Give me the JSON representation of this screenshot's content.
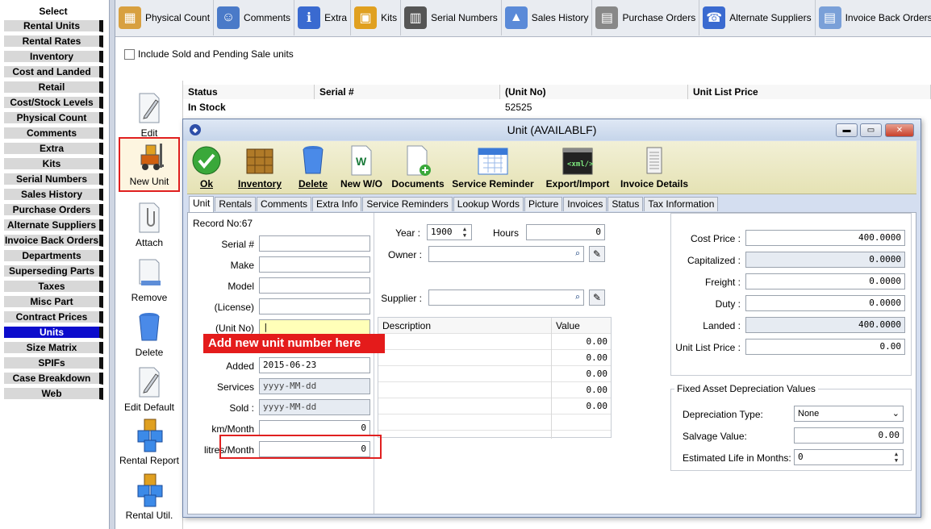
{
  "leftnav": {
    "header": "Select",
    "items": [
      {
        "label": "Rental Units",
        "active": false
      },
      {
        "label": "Rental Rates",
        "active": false
      },
      {
        "label": "Inventory",
        "active": false
      },
      {
        "label": "Cost and Landed",
        "active": false
      },
      {
        "label": "Retail",
        "active": false
      },
      {
        "label": "Cost/Stock Levels",
        "active": false
      },
      {
        "label": "Physical Count",
        "active": false
      },
      {
        "label": "Comments",
        "active": false
      },
      {
        "label": "Extra",
        "active": false
      },
      {
        "label": "Kits",
        "active": false
      },
      {
        "label": "Serial Numbers",
        "active": false
      },
      {
        "label": "Sales History",
        "active": false
      },
      {
        "label": "Purchase Orders",
        "active": false
      },
      {
        "label": "Alternate Suppliers",
        "active": false
      },
      {
        "label": "Invoice Back Orders",
        "active": false
      },
      {
        "label": "Departments",
        "active": false
      },
      {
        "label": "Superseding Parts",
        "active": false
      },
      {
        "label": "Taxes",
        "active": false
      },
      {
        "label": "Misc Part",
        "active": false
      },
      {
        "label": "Contract Prices",
        "active": false
      },
      {
        "label": "Units",
        "active": true
      },
      {
        "label": "Size Matrix",
        "active": false
      },
      {
        "label": "SPIFs",
        "active": false
      },
      {
        "label": "Case Breakdown",
        "active": false
      },
      {
        "label": "Web",
        "active": false
      }
    ]
  },
  "toptoolbar": {
    "items": [
      {
        "label": "Physical Count",
        "icon": "clipboard-box-icon"
      },
      {
        "label": "Comments",
        "icon": "people-icon"
      },
      {
        "label": "Extra",
        "icon": "info-icon"
      },
      {
        "label": "Kits",
        "icon": "boxes-icon"
      },
      {
        "label": "Serial Numbers",
        "icon": "barcode-icon"
      },
      {
        "label": "Sales History",
        "icon": "chart-icon"
      },
      {
        "label": "Purchase Orders",
        "icon": "calculator-icon"
      },
      {
        "label": "Alternate Suppliers",
        "icon": "person-phone-icon"
      },
      {
        "label": "Invoice Back Orders",
        "icon": "invoice-icon"
      }
    ]
  },
  "include_sold_label": "Include Sold and Pending Sale units",
  "side_actions": {
    "edit": "Edit",
    "new_unit": "New Unit",
    "attach": "Attach",
    "remove": "Remove",
    "delete": "Delete",
    "edit_default": "Edit Default",
    "rental_report": "Rental Report",
    "rental_util": "Rental Util."
  },
  "grid": {
    "headers": [
      "Status",
      "Serial #",
      "(Unit No)",
      "Unit List Price"
    ],
    "row": {
      "status": "In Stock",
      "serial": "",
      "unit_no": "52525",
      "price": ""
    }
  },
  "dialog": {
    "title": "Unit  (AVAILABLF)",
    "window_buttons": {
      "minimize": "▬",
      "maximize": "▭",
      "close": "✕"
    },
    "toolbar": {
      "ok": "Ok",
      "inventory": "Inventory",
      "delete": "Delete",
      "new_wo": "New W/O",
      "documents": "Documents",
      "service_reminder": "Service Reminder",
      "export_import": "Export/Import",
      "invoice_details": "Invoice Details"
    },
    "tabs": [
      "Unit",
      "Rentals",
      "Comments",
      "Extra Info",
      "Service Reminders",
      "Lookup Words",
      "Picture",
      "Invoices",
      "Status",
      "Tax Information"
    ],
    "record_no": "Record No:67",
    "left": {
      "serial_label": "Serial #",
      "make_label": "Make",
      "model_label": "Model",
      "license_label": "(License)",
      "unit_no_label": "(Unit No)",
      "added_label": "Added",
      "added_value": "2015-06-23",
      "services_label": "Services",
      "services_value": "yyyy-MM-dd",
      "sold_label": "Sold :",
      "sold_value": "yyyy-MM-dd",
      "km_label": "km/Month",
      "km_value": "0",
      "litres_label": "litres/Month",
      "litres_value": "0"
    },
    "callout": "Add new unit number here",
    "middle": {
      "year_label": "Year :",
      "year_value": "1900",
      "hours_label": "Hours",
      "hours_value": "0",
      "owner_label": "Owner :",
      "supplier_label": "Supplier :",
      "desc_header": "Description",
      "value_header": "Value",
      "values": [
        "0.00",
        "0.00",
        "0.00",
        "0.00",
        "0.00",
        ""
      ]
    },
    "right": {
      "cost_price_label": "Cost Price :",
      "cost_price_value": "400.0000",
      "capitalized_label": "Capitalized :",
      "capitalized_value": "0.0000",
      "freight_label": "Freight :",
      "freight_value": "0.0000",
      "duty_label": "Duty :",
      "duty_value": "0.0000",
      "landed_label": "Landed :",
      "landed_value": "400.0000",
      "unit_list_price_label": "Unit List Price :",
      "unit_list_price_value": "0.00",
      "fixed_asset_title": "Fixed Asset Depreciation Values",
      "depreciation_label": "Depreciation Type:",
      "depreciation_value": "None",
      "salvage_label": "Salvage Value:",
      "salvage_value": "0.00",
      "life_label": "Estimated Life in Months:",
      "life_value": "0"
    }
  }
}
